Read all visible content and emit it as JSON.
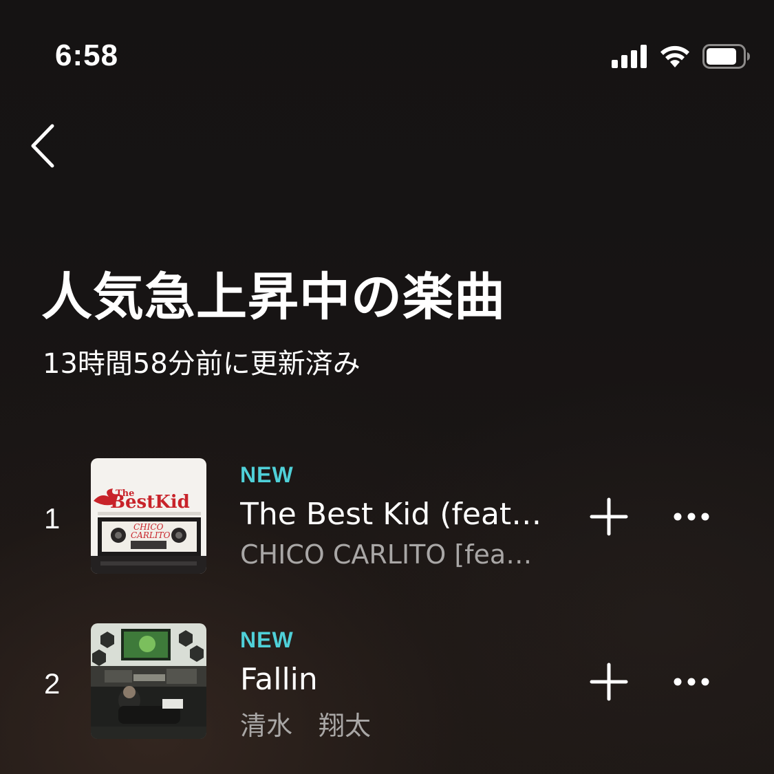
{
  "status_bar": {
    "time": "6:58",
    "icons": [
      "cellular-signal-icon",
      "wifi-icon",
      "battery-icon"
    ]
  },
  "nav": {
    "back_icon": "chevron-left-icon"
  },
  "header": {
    "title": "人気急上昇中の楽曲",
    "subtitle": "13時間58分前に更新済み"
  },
  "tracks": [
    {
      "rank": "1",
      "badge": "NEW",
      "title": "The Best Kid (feat. Bonbero)",
      "artist": "CHICO CARLITO [feat. Bonbero]",
      "artwork": {
        "logo_text": "The BestKid",
        "cover_text": "CHICO CARLITO feat. Bonbero"
      }
    },
    {
      "rank": "2",
      "badge": "NEW",
      "title": "Fallin",
      "artist": "清水　翔太"
    }
  ],
  "colors": {
    "accent": "#4fd0d8",
    "text_primary": "#ffffff",
    "text_secondary": "#a9a7a6",
    "background": "#151313"
  }
}
